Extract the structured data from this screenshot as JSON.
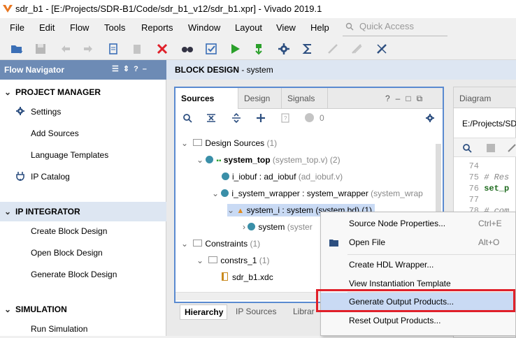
{
  "window": {
    "title": "sdr_b1 - [E:/Projects/SDR-B1/Code/sdr_b1_v12/sdr_b1.xpr] - Vivado 2019.1"
  },
  "menu": [
    "File",
    "Edit",
    "Flow",
    "Tools",
    "Reports",
    "Window",
    "Layout",
    "View",
    "Help"
  ],
  "quick_access": {
    "placeholder": "Quick Access"
  },
  "flow_navigator": {
    "title": "Flow Navigator",
    "project_manager": {
      "label": "PROJECT MANAGER",
      "items": [
        "Settings",
        "Add Sources",
        "Language Templates",
        "IP Catalog"
      ]
    },
    "ip_integrator": {
      "label": "IP INTEGRATOR",
      "items": [
        "Create Block Design",
        "Open Block Design",
        "Generate Block Design"
      ]
    },
    "simulation": {
      "label": "SIMULATION",
      "items": [
        "Run Simulation"
      ]
    }
  },
  "block_design": {
    "label": "BLOCK DESIGN",
    "name": " - system"
  },
  "sources": {
    "tabs": [
      "Sources",
      "Design",
      "Signals"
    ],
    "count": "0",
    "tree": {
      "design_sources": "Design Sources",
      "design_sources_count": " (1)",
      "system_top": "system_top",
      "system_top_file": " (system_top.v) (2)",
      "i_iobuf": "i_iobuf : ad_iobuf",
      "i_iobuf_file": " (ad_iobuf.v)",
      "i_system_wrapper": "i_system_wrapper : system_wrapper",
      "i_system_wrapper_file": " (system_wrap",
      "system_i": "system_i : system (system.bd) (1)",
      "system": "system",
      "system_file": " (syster",
      "constraints": "Constraints",
      "constraints_count": " (1)",
      "constrs_1": "constrs_1",
      "constrs_1_count": " (1)",
      "xdc": "sdr_b1.xdc"
    },
    "bottom_tabs": [
      "Hierarchy",
      "IP Sources",
      "Librar"
    ]
  },
  "diagram": {
    "tab": "Diagram",
    "path": "E:/Projects/SDR",
    "lines": [
      {
        "n": "74",
        "t": ""
      },
      {
        "n": "75",
        "t": "# Res"
      },
      {
        "n": "76",
        "t": "set_p"
      },
      {
        "n": "77",
        "t": ""
      },
      {
        "n": "78",
        "t": "# com"
      }
    ]
  },
  "context_menu": {
    "items": [
      {
        "label": "Source Node Properties...",
        "shortcut": "Ctrl+E"
      },
      {
        "label": "Open File",
        "shortcut": "Alt+O"
      },
      {
        "label": "Create HDL Wrapper...",
        "shortcut": ""
      },
      {
        "label": "View Instantiation Template",
        "shortcut": ""
      },
      {
        "label": "Generate Output Products...",
        "shortcut": ""
      },
      {
        "label": "Reset Output Products...",
        "shortcut": ""
      }
    ]
  },
  "colors": {
    "accent": "#5a8ad0",
    "highlight_box": "#e0202a",
    "selection": "#c9daf4",
    "nav_header": "#6d8bb5"
  }
}
